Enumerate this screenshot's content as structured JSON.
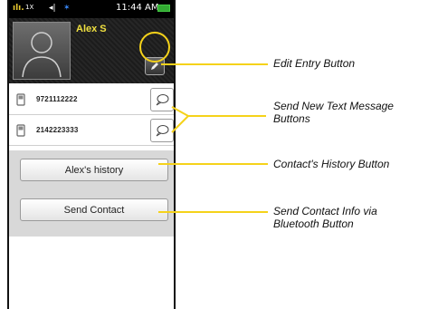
{
  "status_bar": {
    "signal": "ɨı.",
    "network": "1X",
    "extra": "◦",
    "bluetooth": "✶",
    "time": "11:44 AM"
  },
  "contact": {
    "name": "Alex S",
    "numbers": [
      {
        "value": "9721112222"
      },
      {
        "value": "2142223333"
      }
    ]
  },
  "buttons": {
    "history": "Alex's history",
    "send_contact": "Send Contact"
  },
  "callouts": {
    "edit_entry": "Edit Entry Button",
    "send_text_line1": "Send New Text Message",
    "send_text_line2": "Buttons",
    "history": "Contact's History Button",
    "send_info_line1": "Send Contact Info via",
    "send_info_line2": "Bluetooth Button"
  },
  "colors": {
    "accent": "#f5d21a",
    "name": "#f0e040"
  },
  "icons": [
    "signal-icon",
    "bluetooth-icon",
    "battery-icon",
    "avatar-silhouette-icon",
    "pencil-icon",
    "mobile-phone-icon",
    "speech-bubble-icon"
  ]
}
